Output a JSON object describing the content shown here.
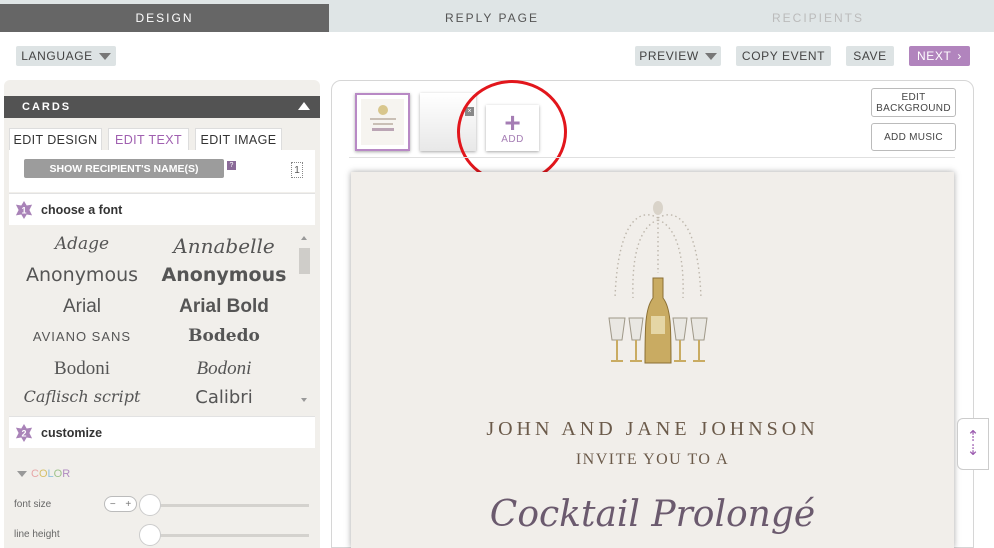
{
  "topnav": {
    "tabs": [
      "DESIGN",
      "REPLY PAGE",
      "RECIPIENTS"
    ]
  },
  "toolbar": {
    "language": "LANGUAGE",
    "preview": "PREVIEW",
    "copy_event": "COPY EVENT",
    "save": "SAVE",
    "next": "NEXT"
  },
  "colors": {
    "accent": "#b184bd",
    "active_tab": "#666666",
    "annotation_circle": "#e2161c"
  },
  "left_panel": {
    "cards_label": "CARDS",
    "edit_tabs": [
      "EDIT DESIGN",
      "EDIT TEXT",
      "EDIT IMAGE"
    ],
    "show_recipient": "SHOW RECIPIENT'S NAME(S)",
    "help": "?",
    "page_number": "1",
    "step1_num": "1",
    "step1_label": "choose a font",
    "fonts": [
      "Adage",
      "Annabelle",
      "Anonymous",
      "Anonymous",
      "Arial",
      "Arial Bold",
      "AVIANO SANS",
      "Bodedo",
      "Bodoni",
      "Bodoni",
      "Caflisch script",
      "Calibri"
    ],
    "step2_num": "2",
    "step2_label": "customize",
    "color_label": [
      "C",
      "O",
      "L",
      "O",
      "R"
    ],
    "font_size_label": "font size",
    "line_height_label": "line height",
    "stepper_minus": "−",
    "stepper_plus": "+"
  },
  "main": {
    "add_label": "ADD",
    "add_plus": "+",
    "edit_background": "EDIT BACKGROUND",
    "add_music": "ADD MUSIC",
    "card": {
      "names": "JOHN AND JANE JOHNSON",
      "invite": "INVITE YOU TO A",
      "event_title": "Cocktail Prolongé"
    }
  }
}
